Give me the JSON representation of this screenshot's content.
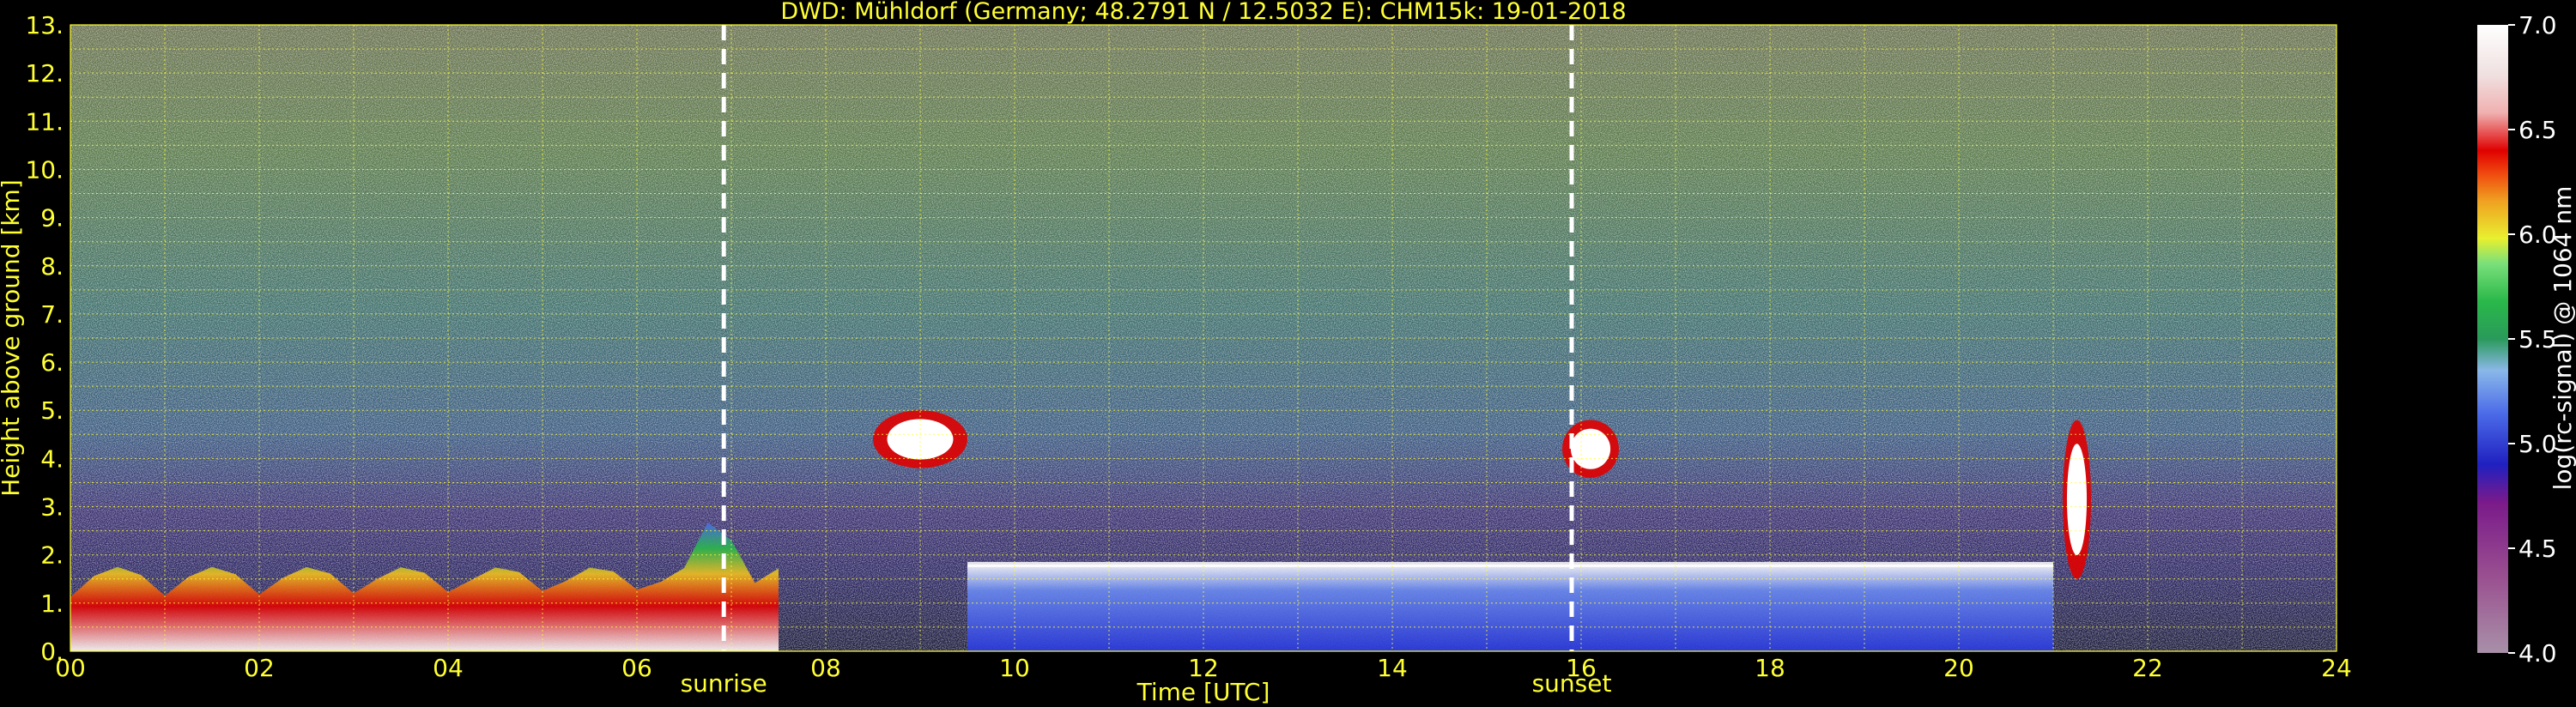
{
  "chart_data": {
    "type": "heatmap",
    "title": "DWD: Mühldorf (Germany; 48.2791 N / 12.5032 E):    CHM15k: 19-01-2018",
    "xlabel": "Time [UTC]",
    "ylabel": "Height above ground [km]",
    "xlim": [
      0,
      24
    ],
    "ylim": [
      0,
      13
    ],
    "x_ticks": [
      "00",
      "02",
      "04",
      "06",
      "08",
      "10",
      "12",
      "14",
      "16",
      "18",
      "20",
      "22",
      "24"
    ],
    "y_ticks": [
      "0.",
      "1.",
      "2.",
      "3.",
      "4.",
      "5.",
      "6.",
      "7.",
      "8.",
      "9.",
      "10.",
      "11.",
      "12.",
      "13."
    ],
    "grid": true,
    "colorbar": {
      "label": "log(rc-signal) @ 1064 nm",
      "range": [
        4.0,
        7.0
      ],
      "ticks": [
        "4.0",
        "4.5",
        "5.0",
        "5.5",
        "6.0",
        "6.5",
        "7.0"
      ]
    },
    "annotations": [
      {
        "label": "sunrise",
        "time_utc": 6.92
      },
      {
        "label": "sunset",
        "time_utc": 15.9
      }
    ],
    "features": [
      {
        "kind": "boundary_layer",
        "time_start": 0.0,
        "time_end": 7.5,
        "height_top_km": 2.5
      },
      {
        "kind": "cloud",
        "time_start": 8.5,
        "time_end": 9.5,
        "height_bottom_km": 3.8,
        "height_top_km": 5.0
      },
      {
        "kind": "low_cloud_layer",
        "time_start": 9.5,
        "time_end": 21.0,
        "height_top_km": 1.8
      },
      {
        "kind": "cloud",
        "time_start": 15.8,
        "time_end": 16.4,
        "height_bottom_km": 3.6,
        "height_top_km": 4.8
      },
      {
        "kind": "cloud",
        "time_start": 21.1,
        "time_end": 21.4,
        "height_bottom_km": 1.5,
        "height_top_km": 4.8
      }
    ]
  }
}
